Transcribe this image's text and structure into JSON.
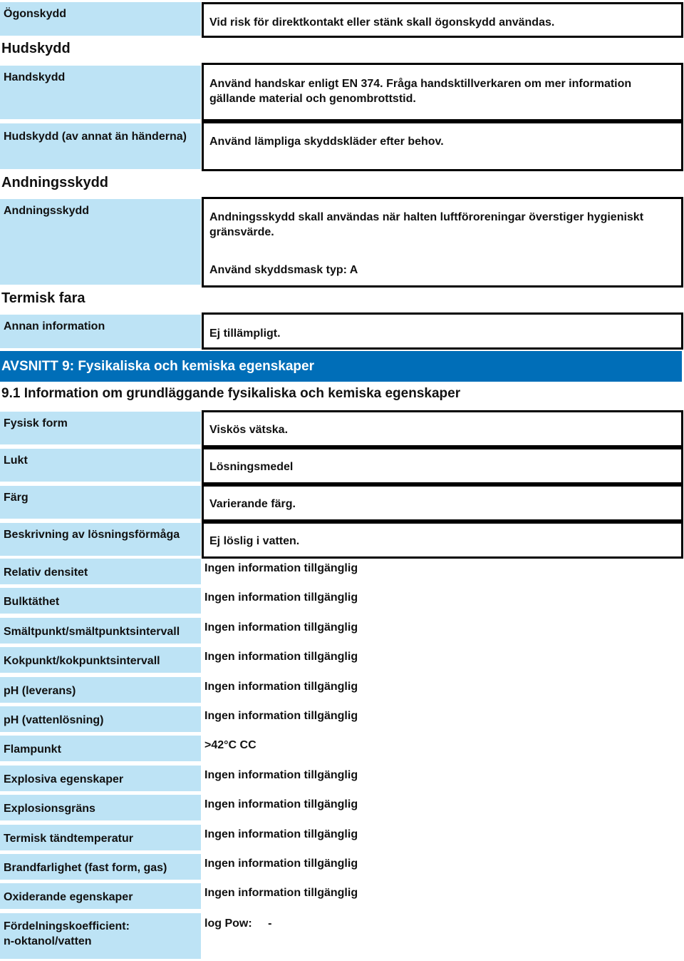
{
  "protection": {
    "eye": {
      "label": "Ögonskydd",
      "value": "Vid risk för direktkontakt eller stänk skall ögonskydd användas."
    },
    "skin_heading": "Hudskydd",
    "hand": {
      "label": "Handskydd",
      "value": "Använd handskar enligt EN 374. Fråga handsktillverkaren om mer information gällande material och genombrottstid."
    },
    "skin_other": {
      "label": "Hudskydd (av annat än händerna)",
      "value": "Använd lämpliga skyddskläder efter behov."
    },
    "respiratory_heading": "Andningsskydd",
    "respiratory": {
      "label": "Andningsskydd",
      "value": "Andningsskydd skall användas när halten luftföroreningar överstiger hygieniskt gränsvärde.",
      "value2": "Använd skyddsmask typ: A"
    },
    "thermal_heading": "Termisk fara",
    "other_info": {
      "label": "Annan information",
      "value": "Ej tillämpligt."
    }
  },
  "section9": {
    "title": "AVSNITT 9: Fysikaliska och kemiska egenskaper",
    "subtitle": "9.1 Information om grundläggande fysikaliska och kemiska egenskaper",
    "boxed_rows": [
      {
        "label": "Fysisk form",
        "value": "Viskös vätska."
      },
      {
        "label": "Lukt",
        "value": "Lösningsmedel"
      },
      {
        "label": "Färg",
        "value": "Varierande färg."
      },
      {
        "label": "Beskrivning av lösningsförmåga",
        "value": "Ej löslig i vatten."
      }
    ],
    "plain_rows": [
      {
        "label": "Relativ densitet",
        "value": "Ingen information tillgänglig"
      },
      {
        "label": "Bulktäthet",
        "value": "Ingen information tillgänglig"
      },
      {
        "label": "Smältpunkt/smältpunktsintervall",
        "value": "Ingen information tillgänglig"
      },
      {
        "label": "Kokpunkt/kokpunktsintervall",
        "value": "Ingen information tillgänglig"
      },
      {
        "label": "pH (leverans)",
        "value": "Ingen information tillgänglig"
      },
      {
        "label": "pH (vattenlösning)",
        "value": "Ingen information tillgänglig"
      },
      {
        "label": "Flampunkt",
        "value": ">42°C  CC"
      },
      {
        "label": "Explosiva egenskaper",
        "value": "Ingen information tillgänglig"
      },
      {
        "label": "Explosionsgräns",
        "value": "Ingen information tillgänglig"
      },
      {
        "label": "Termisk tändtemperatur",
        "value": "Ingen information tillgänglig"
      },
      {
        "label": "Brandfarlighet (fast form, gas)",
        "value": "Ingen information tillgänglig"
      },
      {
        "label": "Oxiderande egenskaper",
        "value": "Ingen information tillgänglig"
      }
    ],
    "partition": {
      "label_line1": "Fördelningskoefficient:",
      "label_line2": "n-oktanol/vatten",
      "value_label": "log Pow:",
      "value": "-"
    }
  },
  "colors": {
    "label_bg": "#bde3f5",
    "section_bar": "#006eb8"
  }
}
